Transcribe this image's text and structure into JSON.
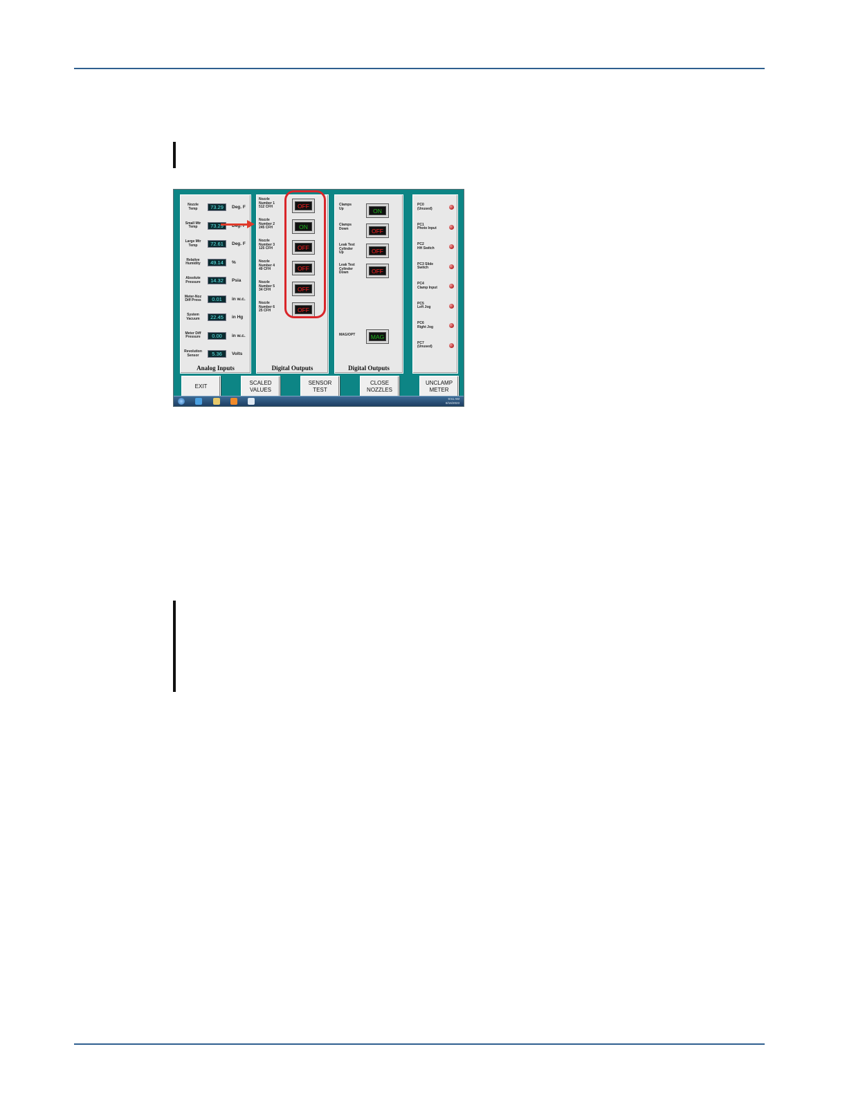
{
  "analog_inputs": {
    "title": "Analog Inputs",
    "rows": [
      {
        "label": "Nozzle\nTemp",
        "value": "73.29",
        "unit": "Deg. F"
      },
      {
        "label": "Small Mtr\nTemp",
        "value": "73.29",
        "unit": "Deg. F"
      },
      {
        "label": "Large Mtr\nTemp",
        "value": "72.61",
        "unit": "Deg. F"
      },
      {
        "label": "Relative\nHumidity",
        "value": "49.14",
        "unit": "%"
      },
      {
        "label": "Absolute\nPressure",
        "value": "14.32",
        "unit": "Psia"
      },
      {
        "label": "Meter-Noz\nDiff Press",
        "value": "0.01",
        "unit": "in w.c."
      },
      {
        "label": "System\nVacuum",
        "value": "22.45",
        "unit": "in Hg"
      },
      {
        "label": "Meter Diff\nPressure",
        "value": "0.00",
        "unit": "in w.c."
      },
      {
        "label": "Revolution\nSensor",
        "value": "5.36",
        "unit": "Volts"
      }
    ]
  },
  "nozzle_outputs": {
    "title": "Digital Outputs",
    "rows": [
      {
        "label": "Nozzle\nNumber 1\n512 CFH",
        "state": "OFF"
      },
      {
        "label": "Nozzle\nNumber 2\n245 CFH",
        "state": "ON"
      },
      {
        "label": "Nozzle\nNumber 3\n125 CFH",
        "state": "OFF"
      },
      {
        "label": "Nozzle\nNumber 4\n49 CFH",
        "state": "OFF"
      },
      {
        "label": "Nozzle\nNumber 5\n34 CFH",
        "state": "OFF"
      },
      {
        "label": "Nozzle\nNumber 6\n25 CFH",
        "state": "OFF"
      }
    ]
  },
  "clamp_outputs": {
    "title": "Digital Outputs",
    "rows": [
      {
        "label": "Clamps\nUp",
        "state": "ON"
      },
      {
        "label": "Clamps\nDown",
        "state": "OFF"
      },
      {
        "label": "Leak Test\nCylinder\nUp",
        "state": "OFF"
      },
      {
        "label": "Leak Test\nCylinder\nDown",
        "state": "OFF"
      }
    ],
    "mag": {
      "label": "MAG/OPT",
      "state": "MAG"
    }
  },
  "inputs": {
    "rows": [
      {
        "label": "PC0\n(Unused)"
      },
      {
        "label": "PC1\nPhoto Input"
      },
      {
        "label": "PC2\nHH Switch"
      },
      {
        "label": "PC3 Slide\nSwitch"
      },
      {
        "label": "PC4\nClamp Input"
      },
      {
        "label": "PC5\nLeft Jog"
      },
      {
        "label": "PC6\nRight Jog"
      },
      {
        "label": "PC7\n(Unused)"
      }
    ]
  },
  "buttons": [
    "EXIT",
    "SCALED\nVALUES",
    "SENSOR\nTEST",
    "CLOSE\nNOZZLES",
    "UNCLAMP\nMETER"
  ],
  "taskbar": {
    "time": "9:51 AM",
    "date": "8/16/2023"
  },
  "colors": {
    "rule": "#2f5f8f",
    "screen_bg": "#0d8585",
    "lcd_text": "#5ff0f0",
    "off": "#ff2020",
    "on": "#1fb61f",
    "highlight": "#d9262a"
  }
}
